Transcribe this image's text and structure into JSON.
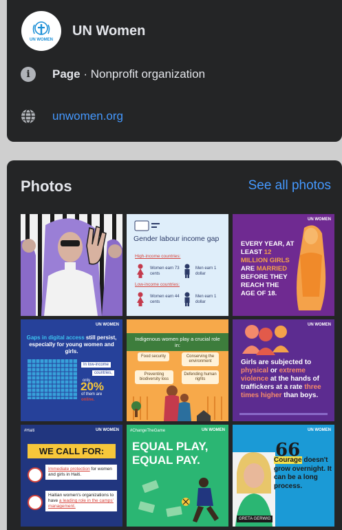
{
  "profile": {
    "name": "UN Women",
    "logo_text": "UN WOMEN"
  },
  "info": {
    "page_type_bold": "Page",
    "page_type_rest": " · Nonprofit organization",
    "website": "unwomen.org",
    "page_icon": "info-icon",
    "web_icon": "globe-icon"
  },
  "photos": {
    "title": "Photos",
    "see_all": "See all photos",
    "watermark": "UN WOMEN",
    "tiles": {
      "t2": {
        "head": "Gender labour income gap",
        "high": "High-income countries:",
        "low": "Low-income countries:",
        "women_high": "Women earn 73 cents",
        "men_high": "Men earn 1 dollar",
        "women_low": "Women earn 44 cents",
        "men_low": "Men earn 1 dollar"
      },
      "t3": {
        "line1": "EVERY YEAR, AT LEAST",
        "hl1": "12 MILLION GIRLS",
        "line2": "ARE",
        "hl2": "MARRIED",
        "line3": "BEFORE THEY REACH THE AGE OF 18."
      },
      "t4": {
        "hl": "Gaps in digital access",
        "text": "still persist, especially for young women and girls.",
        "box1": "In low-income",
        "box2": "countries,",
        "only": "only",
        "pct": "20%",
        "of": "of them are",
        "online": "online."
      },
      "t5": {
        "head": "Indigenous women play a crucial role in:",
        "p1": "Food security",
        "p2": "Conserving the environment",
        "p3": "Preventing biodiversity loss",
        "p4": "Defending human rights"
      },
      "t6": {
        "a": "Girls are subjected to",
        "b": "physical",
        "c": "or",
        "d": "extreme violence",
        "e": "at the hands of traffickers at a rate",
        "f": "three times higher",
        "g": "than boys."
      },
      "t7": {
        "tag": "#Haiti",
        "call": "WE CALL FOR:",
        "i1u": "Immediate protection",
        "i1": "for women and girls in Haiti.",
        "i2": "Haitian women's organizations to have",
        "i2u": "a leading role in the camps' management."
      },
      "t8": {
        "tag": "#ChangeTheGame",
        "line1": "EQUAL PLAY,",
        "line2": "EQUAL PAY."
      },
      "t9": {
        "quote": "66",
        "hl": "Courage",
        "text": "doesn't grow overnight. It can be a long process.",
        "name": "GRETA GERWIG"
      }
    }
  },
  "colors": {
    "panel": "#242526",
    "link": "#4599ff",
    "text": "#e4e6eb"
  }
}
